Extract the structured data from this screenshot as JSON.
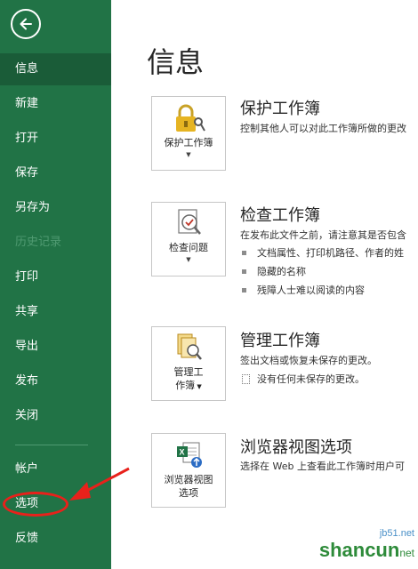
{
  "sidebar": {
    "items": [
      {
        "label": "信息",
        "active": true
      },
      {
        "label": "新建"
      },
      {
        "label": "打开"
      },
      {
        "label": "保存"
      },
      {
        "label": "另存为"
      },
      {
        "label": "历史记录",
        "disabled": true
      },
      {
        "label": "打印"
      },
      {
        "label": "共享"
      },
      {
        "label": "导出"
      },
      {
        "label": "发布"
      },
      {
        "label": "关闭"
      },
      {
        "label": "帐户"
      },
      {
        "label": "选项"
      },
      {
        "label": "反馈"
      }
    ]
  },
  "main": {
    "title": "信息",
    "sections": [
      {
        "button_label": "保护工作簿",
        "title": "保护工作簿",
        "description": "控制其他人可以对此工作簿所做的更改"
      },
      {
        "button_label": "检查问题",
        "title": "检查工作簿",
        "description": "在发布此文件之前，请注意其是否包含",
        "bullets": [
          "文档属性、打印机路径、作者的姓",
          "隐藏的名称",
          "残障人士难以阅读的内容"
        ]
      },
      {
        "button_label_line1": "管理工",
        "button_label_line2": "作簿",
        "title": "管理工作簿",
        "description": "签出文档或恢复未保存的更改。",
        "note": "没有任何未保存的更改。"
      },
      {
        "button_label_line1": "浏览器视图",
        "button_label_line2": "选项",
        "title": "浏览器视图选项",
        "description": "选择在 Web 上查看此工作簿时用户可"
      }
    ]
  },
  "watermark": {
    "site": "jb51.net",
    "brand": "shancun",
    "sub": "net"
  },
  "colors": {
    "sidebar": "#217346",
    "sidebar_active": "#1a5c38",
    "annotation": "#e8211b"
  }
}
